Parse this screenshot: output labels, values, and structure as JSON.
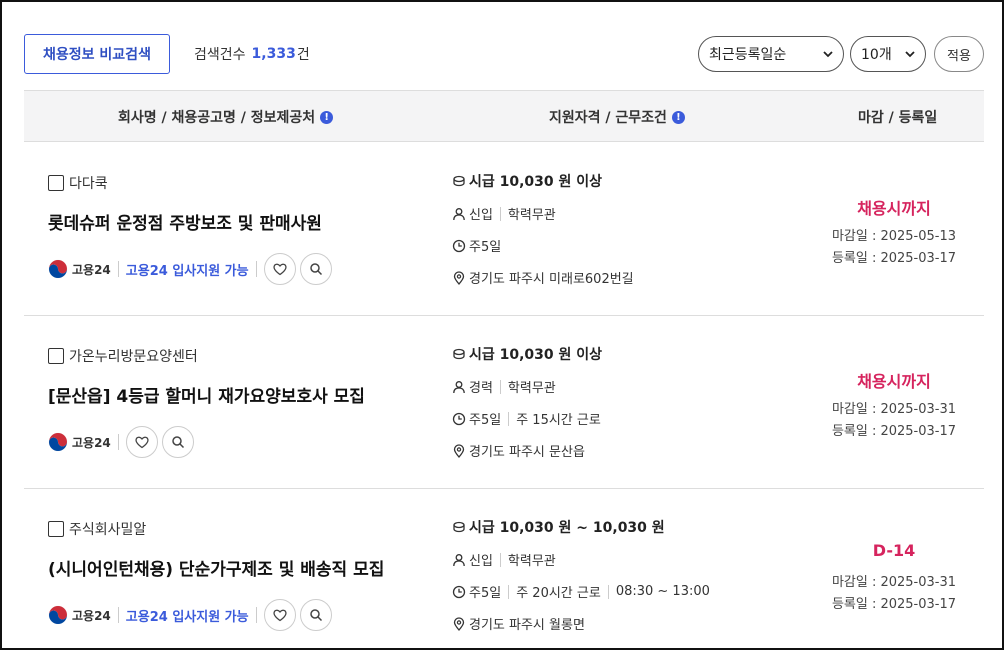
{
  "toolbar": {
    "compare_label": "채용정보 비교검색",
    "count_label": "검색건수",
    "count_value": "1,333",
    "count_unit": "건",
    "sort_value": "최근등록일순",
    "per_page_value": "10개",
    "apply_label": "적용"
  },
  "table": {
    "headers": [
      "회사명 / 채용공고명 / 정보제공처",
      "지원자격 / 근무조건",
      "마감 / 등록일"
    ],
    "rows": [
      {
        "company": "다다쿡",
        "title": "롯데슈퍼 운정점 주방보조 및 판매사원",
        "source": "고용24",
        "support": "고용24 입사지원 가능",
        "pay": "시급 10,030 원 이상",
        "career": "신입",
        "education": "학력무관",
        "days": "주5일",
        "hours": "",
        "time": "",
        "location": "경기도 파주시 미래로602번길",
        "deadline": "채용시까지",
        "close_date": "마감일 : 2025-05-13",
        "reg_date": "등록일 : 2025-03-17"
      },
      {
        "company": "가온누리방문요양센터",
        "title": "[문산읍] 4등급 할머니 재가요양보호사 모집",
        "source": "고용24",
        "support": "",
        "pay": "시급 10,030 원 이상",
        "career": "경력",
        "education": "학력무관",
        "days": "주5일",
        "hours": "주 15시간 근로",
        "time": "",
        "location": "경기도 파주시 문산읍",
        "deadline": "채용시까지",
        "close_date": "마감일 : 2025-03-31",
        "reg_date": "등록일 : 2025-03-17"
      },
      {
        "company": "주식회사밀알",
        "title": "(시니어인턴채용) 단순가구제조 및 배송직 모집",
        "source": "고용24",
        "support": "고용24 입사지원 가능",
        "pay": "시급 10,030 원 ~ 10,030 원",
        "career": "신입",
        "education": "학력무관",
        "days": "주5일",
        "hours": "주 20시간 근로",
        "time": "08:30 ~ 13:00",
        "location": "경기도 파주시 월롱면",
        "deadline": "D-14",
        "close_date": "마감일 : 2025-03-31",
        "reg_date": "등록일 : 2025-03-17"
      }
    ]
  },
  "icons": {
    "info": "info-icon",
    "chevron": "chevron-down-icon",
    "heart": "heart-icon",
    "search": "search-icon",
    "coin": "coin-icon",
    "person": "person-icon",
    "clock": "clock-icon",
    "pin": "location-pin-icon",
    "logo": "korea-government-emblem"
  },
  "colors": {
    "accent": "#3b5bdb",
    "deadline": "#d6245e",
    "header_bg": "#f4f4f5"
  }
}
